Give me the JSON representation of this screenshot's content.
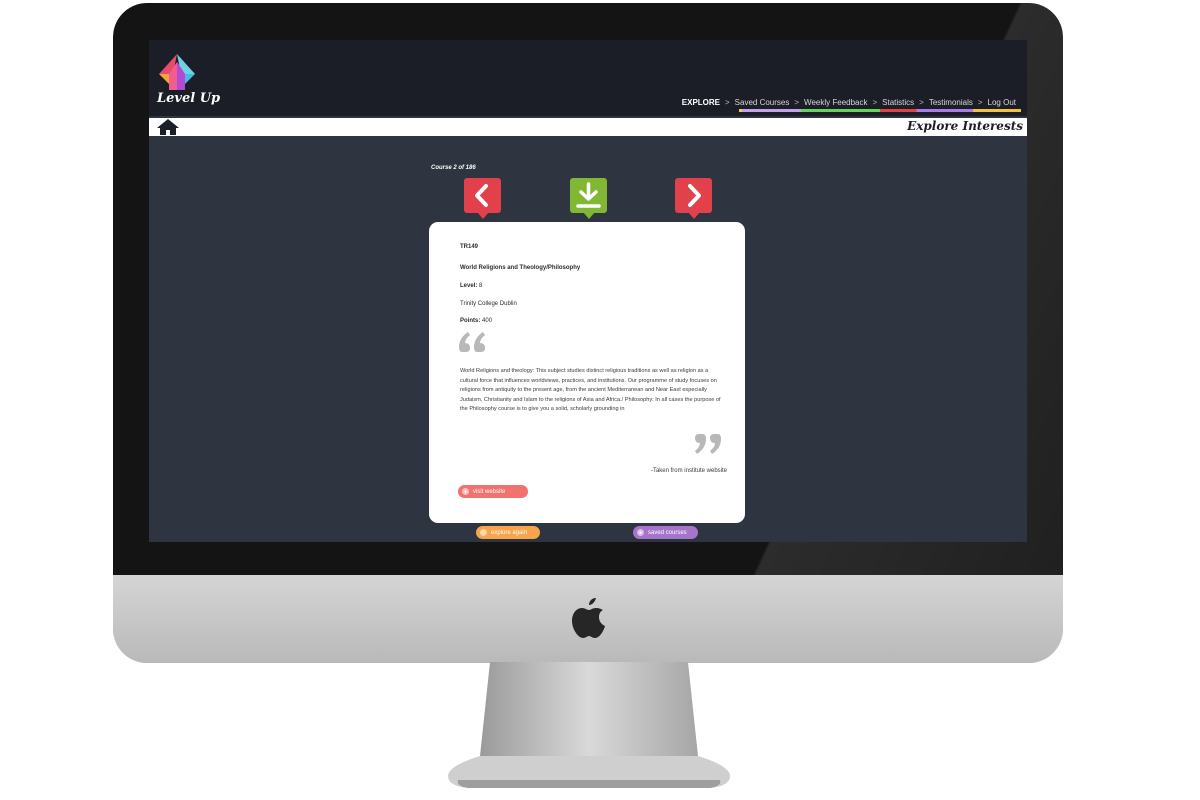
{
  "app": {
    "name": "Level Up"
  },
  "nav": {
    "items": [
      {
        "label": "EXPLORE",
        "active": true
      },
      {
        "label": "Saved Courses",
        "active": false
      },
      {
        "label": "Weekly Feedback",
        "active": false
      },
      {
        "label": "Statistics",
        "active": false
      },
      {
        "label": "Testimonials",
        "active": false
      },
      {
        "label": "Log Out",
        "active": false
      }
    ],
    "separator": ">"
  },
  "page": {
    "title": "Explore Interests",
    "counter": "Course 2 of 186"
  },
  "icons": {
    "home": "home-icon",
    "previous": "chevron-left-icon",
    "save": "download-icon",
    "next": "chevron-right-icon",
    "quote_open": "quote-open-icon",
    "quote_close": "quote-close-icon",
    "visit": "globe-icon",
    "explore_again": "chevron-left-icon",
    "saved_courses": "user-icon"
  },
  "colors": {
    "screen_bg": "#2e3440",
    "topbar_bg": "#1b1d27",
    "nav_red": "#e2414b",
    "save_green": "#80b833",
    "visit_pill": "#f1726e",
    "explore_pill": "#f7a44a",
    "saved_pill": "#a774cc"
  },
  "course": {
    "code": "TR149",
    "title": "World Religions and Theology/Philosophy",
    "level_label": "Level:",
    "level_value": "8",
    "institution": "Trinity College Dublin",
    "points_label": "Points:",
    "points_value": "400",
    "description": "World Religions and theology: This subject studies distinct religious traditions as well as religion as a cultural force that influences worldviews, practices, and institutions. Our programme of study focuses on religions from antiquity to the present age, from the ancient Mediterranean and Near East  especially Judaism, Christianity and Islam  to the religions of Asia and Africa./ Philosophy: In all cases the purpose of the Philosophy course is to give you a solid, scholarly grounding in",
    "source": "-Taken from institute website",
    "visit_label": "visit website"
  },
  "footer": {
    "explore_again_label": "explore again",
    "saved_courses_label": "saved courses"
  }
}
